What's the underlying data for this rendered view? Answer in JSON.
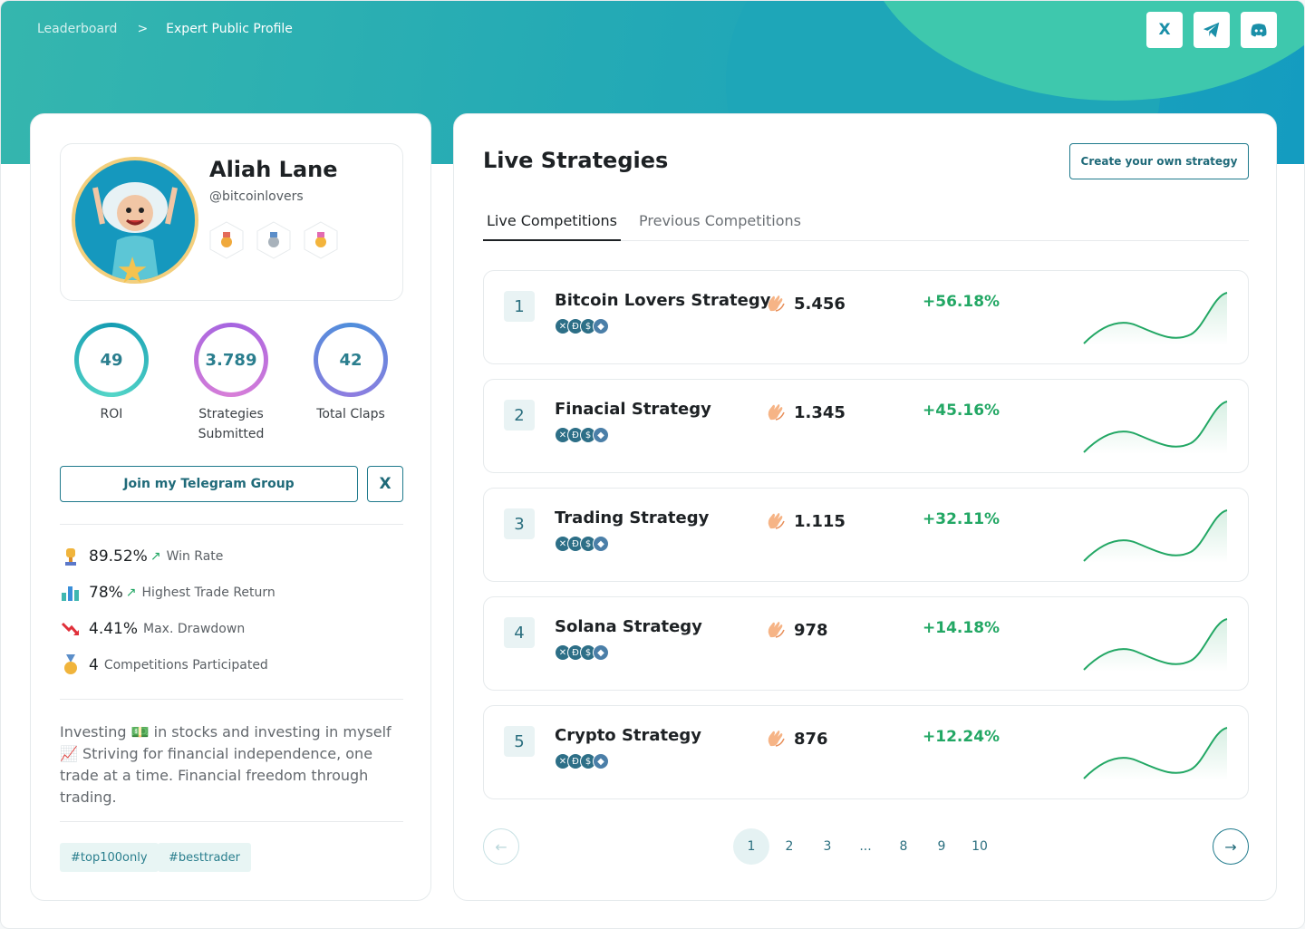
{
  "breadcrumb": {
    "items": [
      "Leaderboard",
      "Expert Public Profile"
    ],
    "separator": ">"
  },
  "social": {
    "x_label": "X",
    "telegram_label": "✈",
    "discord_label": "◉"
  },
  "profile": {
    "name": "Aliah Lane",
    "handle": "@bitcoinlovers",
    "badges": [
      "trophy-badge",
      "silver-medal-badge",
      "gold-medal-badge"
    ]
  },
  "stats": [
    {
      "value": "49",
      "label": "ROI"
    },
    {
      "value": "3.789",
      "label": "Strategies Submitted"
    },
    {
      "value": "42",
      "label": "Total Claps"
    }
  ],
  "actions": {
    "telegram": "Join my Telegram Group",
    "x": "X"
  },
  "metrics": [
    {
      "value": "89.52%",
      "label": "Win Rate",
      "trend": "↗",
      "icon": "trophy-icon"
    },
    {
      "value": "78%",
      "label": "Highest Trade Return",
      "trend": "↗",
      "icon": "bar-chart-icon"
    },
    {
      "value": "4.41%",
      "label": "Max. Drawdown",
      "trend": "",
      "icon": "down-trend-icon"
    },
    {
      "value": "4",
      "label": "Competitions Participated",
      "trend": "",
      "icon": "medal-icon"
    }
  ],
  "bio": "Investing 💵 in stocks and investing in myself 📈 Striving for financial independence, one trade at a time. Financial freedom through trading.",
  "tags": [
    "#top100only",
    "#besttrader"
  ],
  "strategies": {
    "title": "Live Strategies",
    "create_label": "Create your own strategy",
    "tabs": [
      "Live Competitions",
      "Previous Competitions"
    ],
    "rows": [
      {
        "rank": "1",
        "name": "Bitcoin Lovers Strategy",
        "claps": "5.456",
        "gain": "+56.18%"
      },
      {
        "rank": "2",
        "name": "Finacial Strategy",
        "claps": "1.345",
        "gain": "+45.16%"
      },
      {
        "rank": "3",
        "name": "Trading Strategy",
        "claps": "1.115",
        "gain": "+32.11%"
      },
      {
        "rank": "4",
        "name": "Solana Strategy",
        "claps": "978",
        "gain": "+14.18%"
      },
      {
        "rank": "5",
        "name": "Crypto Strategy",
        "claps": "876",
        "gain": "+12.24%"
      }
    ],
    "coins": [
      "✕",
      "Đ",
      "$",
      "◆"
    ]
  },
  "pagination": {
    "pages": [
      "1",
      "2",
      "3",
      "...",
      "8",
      "9",
      "10"
    ],
    "current": "1",
    "prev": "←",
    "next": "→"
  },
  "colors": {
    "accent": "#1f7a8c",
    "gain": "#22a764",
    "hero_start": "#35b6ae",
    "hero_end": "#149cc0"
  }
}
